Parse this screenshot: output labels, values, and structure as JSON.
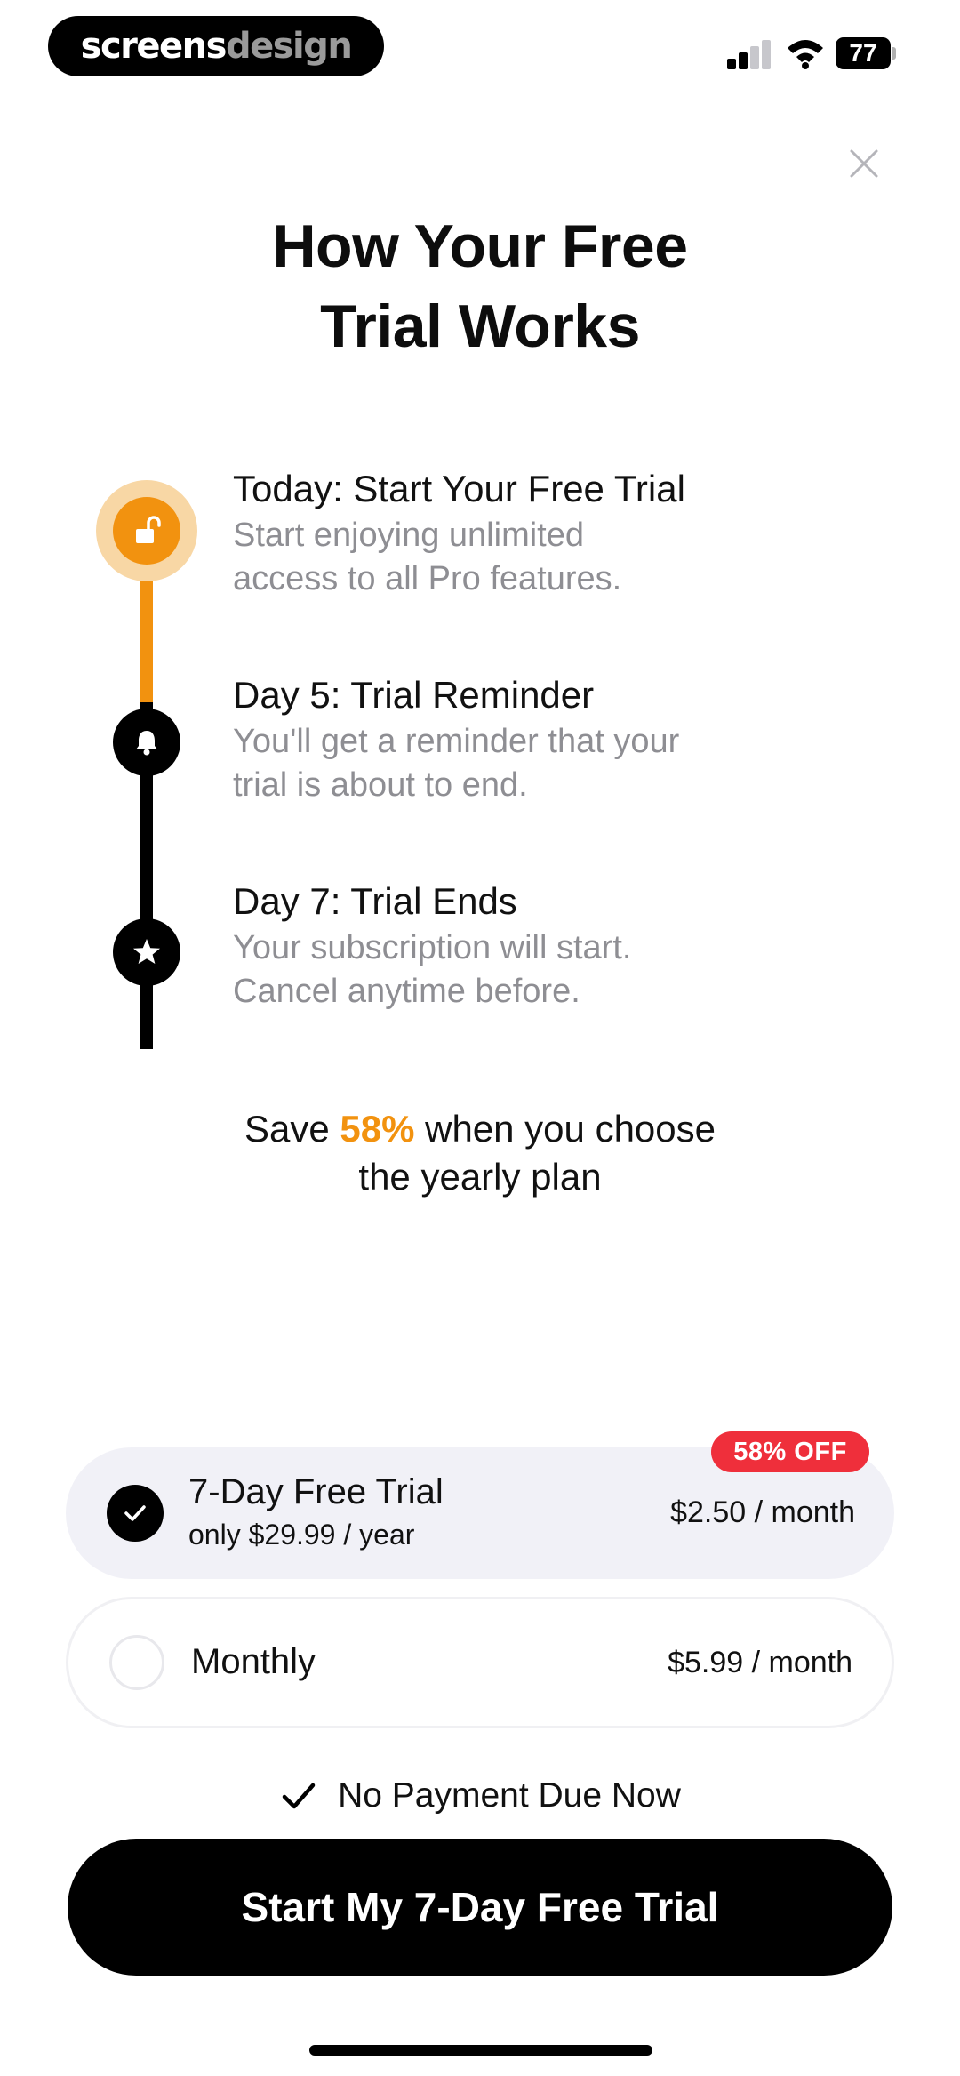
{
  "status_bar": {
    "brand_part1": "screens",
    "brand_part2": "design",
    "battery_level": "77"
  },
  "title": {
    "line1": "How Your Free",
    "line2": "Trial Works"
  },
  "timeline": {
    "steps": [
      {
        "title": "Today: Start Your Free Trial",
        "desc_line1": "Start enjoying unlimited",
        "desc_line2": "access to all Pro features.",
        "icon": "unlock-icon"
      },
      {
        "title": "Day 5: Trial Reminder",
        "desc_line1": "You'll get a reminder that your",
        "desc_line2": "trial is about to end.",
        "icon": "bell-icon"
      },
      {
        "title": "Day 7: Trial Ends",
        "desc_line1": "Your subscription will start.",
        "desc_line2": "Cancel anytime before.",
        "icon": "star-icon"
      }
    ]
  },
  "savings": {
    "prefix": "Save ",
    "percent": "58%",
    "suffix": " when you choose",
    "line2": "the yearly plan"
  },
  "plans": {
    "yearly": {
      "name": "7-Day Free Trial",
      "subtitle": "only $29.99 / year",
      "price": "$2.50 / month",
      "badge": "58% OFF",
      "selected": true
    },
    "monthly": {
      "name": "Monthly",
      "price": "$5.99 / month",
      "selected": false
    }
  },
  "no_payment": "No Payment Due Now",
  "cta_label": "Start My 7-Day Free Trial",
  "colors": {
    "accent": "#f2920f",
    "badge": "#ef2f3b",
    "selected_plan_bg": "#f1f1f7",
    "secondary_text": "#8e8e93"
  }
}
